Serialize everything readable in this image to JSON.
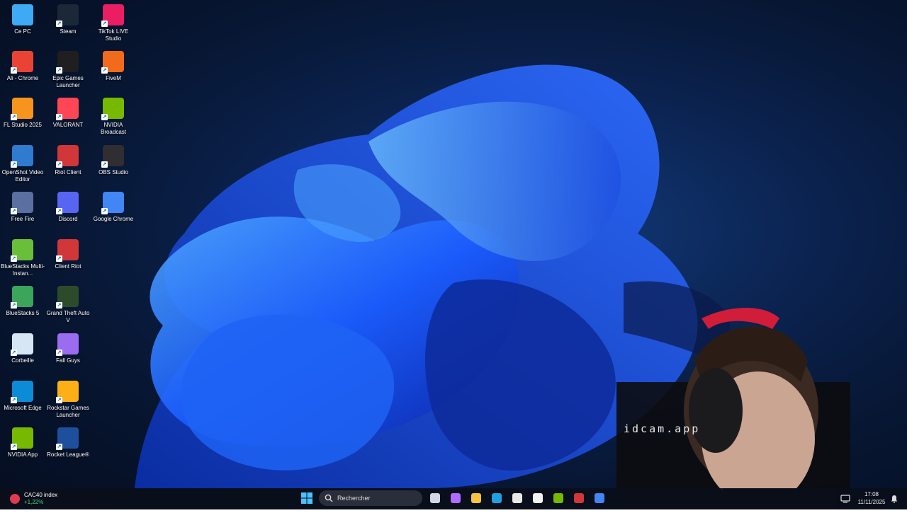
{
  "desktop_icons": [
    {
      "label": "Ce PC",
      "icon": "pc-icon",
      "color": "#3fa9f5"
    },
    {
      "label": "Steam",
      "icon": "steam-icon",
      "color": "#1b2838"
    },
    {
      "label": "TikTok LIVE Studio",
      "icon": "tiktok-icon",
      "color": "#e91e63"
    },
    {
      "label": "Ali - Chrome",
      "icon": "chrome-profile-icon",
      "color": "#ea4335"
    },
    {
      "label": "Epic Games Launcher",
      "icon": "epic-games-icon",
      "color": "#1f1f1f"
    },
    {
      "label": "FiveM",
      "icon": "fivem-icon",
      "color": "#f26b1d"
    },
    {
      "label": "FL Studio 2025",
      "icon": "fl-studio-icon",
      "color": "#f7941d"
    },
    {
      "label": "VALORANT",
      "icon": "valorant-icon",
      "color": "#ff4655"
    },
    {
      "label": "NVIDIA Broadcast",
      "icon": "nvidia-broadcast-icon",
      "color": "#76b900"
    },
    {
      "label": "OpenShot Video Editor",
      "icon": "openshot-icon",
      "color": "#2e7bcf"
    },
    {
      "label": "Riot Client",
      "icon": "riot-client-icon",
      "color": "#d13639"
    },
    {
      "label": "OBS Studio",
      "icon": "obs-icon",
      "color": "#302e31"
    },
    {
      "label": "Free Fire",
      "icon": "free-fire-icon",
      "color": "#5b6fa0"
    },
    {
      "label": "Discord",
      "icon": "discord-icon",
      "color": "#5865f2"
    },
    {
      "label": "Google Chrome",
      "icon": "chrome-icon",
      "color": "#4285f4"
    },
    {
      "label": "BlueStacks Multi-Instan...",
      "icon": "bluestacks-multi-icon",
      "color": "#6abf3a"
    },
    {
      "label": "Client Riot",
      "icon": "riot-client-icon",
      "color": "#d13639"
    },
    {
      "label": "BlueStacks 5",
      "icon": "bluestacks-icon",
      "color": "#3ba55c"
    },
    {
      "label": "Grand Theft Auto V",
      "icon": "gta-v-icon",
      "color": "#2d4b2a"
    },
    {
      "label": "Corbeille",
      "icon": "recycle-bin-icon",
      "color": "#d6e6f5"
    },
    {
      "label": "Fall Guys",
      "icon": "fall-guys-icon",
      "color": "#9b6cf0"
    },
    {
      "label": "Microsoft Edge",
      "icon": "edge-icon",
      "color": "#0c8bd6"
    },
    {
      "label": "Rockstar Games Launcher",
      "icon": "rockstar-icon",
      "color": "#fcaf17"
    },
    {
      "label": "NVIDIA App",
      "icon": "nvidia-app-icon",
      "color": "#76b900"
    },
    {
      "label": "Rocket League®",
      "icon": "rocket-league-icon",
      "color": "#1d4f9c"
    }
  ],
  "widget": {
    "title": "CAC40 index",
    "change": "+1,22%"
  },
  "taskbar": {
    "search_placeholder": "Rechercher",
    "apps": [
      "start-icon",
      "task-view-icon",
      "copilot-icon",
      "file-explorer-icon",
      "edge-icon",
      "store-icon",
      "maps-icon",
      "nvidia-icon",
      "riot-icon",
      "chrome-icon"
    ]
  },
  "clock": {
    "time": "17:08",
    "date": "11/11/2025"
  },
  "overlay": {
    "text": "idcam.app"
  }
}
